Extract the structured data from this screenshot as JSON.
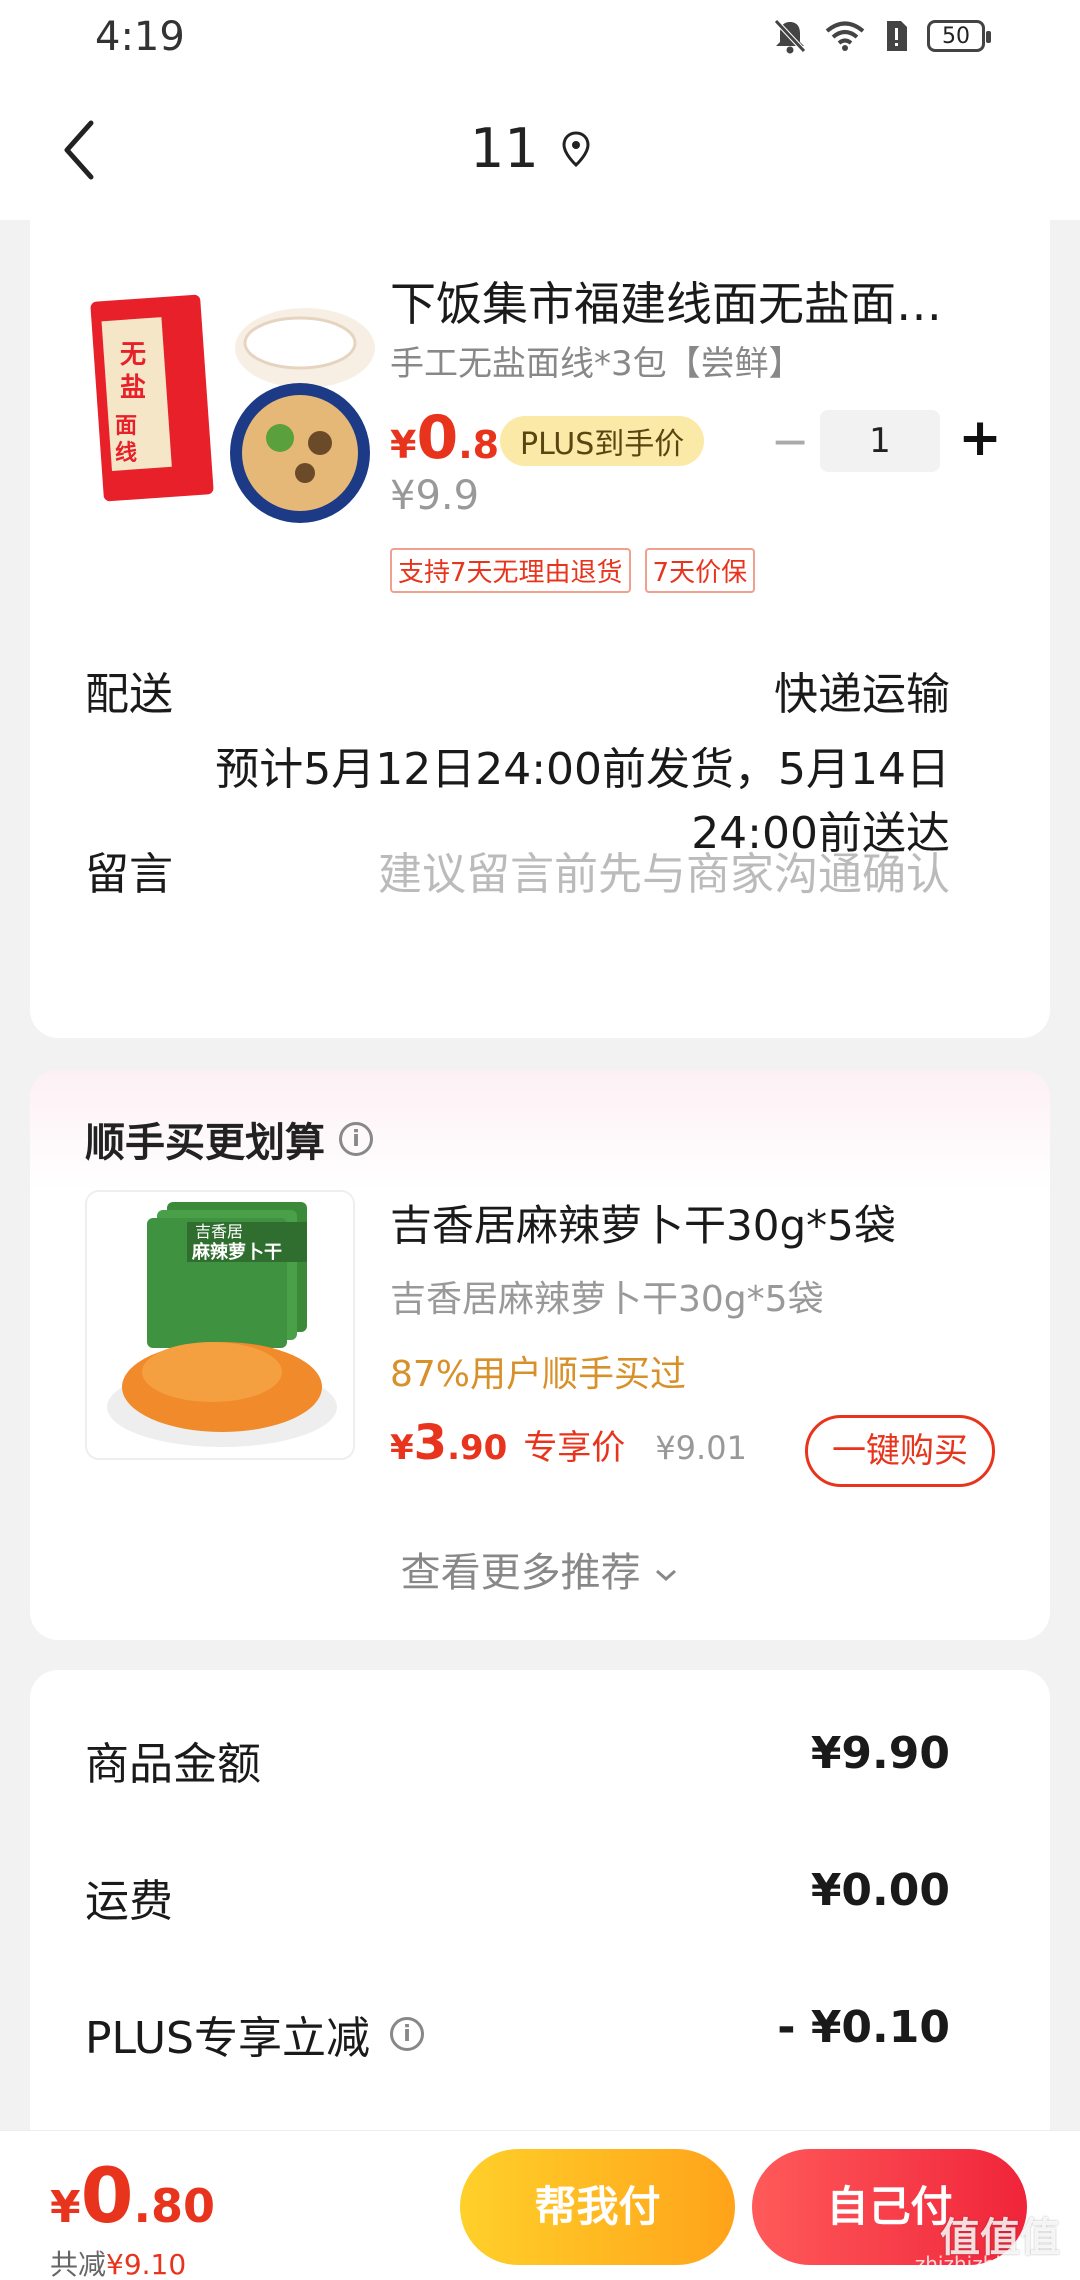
{
  "status": {
    "time": "4:19",
    "battery": "50"
  },
  "nav": {
    "title": "11"
  },
  "product": {
    "title": "下饭集市福建线面无盐面…",
    "subtitle": "手工无盐面线*3包【尝鲜】",
    "price_yen": "¥",
    "price_int": "0",
    "price_dec": ".8",
    "plus_tag": "PLUS到手价",
    "quantity": "1",
    "original_price": "¥9.9",
    "badges": [
      "支持7天无理由退货",
      "7天价保"
    ],
    "image_labels": {
      "package_text": "无盐面线"
    }
  },
  "delivery": {
    "label": "配送",
    "method": "快递运输",
    "note": "预计5月12日24:00前发货，5月14日24:00前送达"
  },
  "message": {
    "label": "留言",
    "placeholder": "建议留言前先与商家沟通确认"
  },
  "recommend": {
    "title": "顺手买更划算",
    "item_name": "吉香居麻辣萝卜干30g*5袋",
    "item_sub": "吉香居麻辣萝卜干30g*5袋",
    "social_proof": "87%用户顺手买过",
    "price_yen": "¥",
    "price_int": "3",
    "price_dec": ".90",
    "price_tag": "专享价",
    "old_price": "¥9.01",
    "buy_label": "一键购买",
    "more_label": "查看更多推荐",
    "image_labels": {
      "brand": "吉香居",
      "product": "麻辣萝卜干"
    }
  },
  "summary": {
    "goods_label": "商品金额",
    "goods_value": "¥9.90",
    "shipping_label": "运费",
    "shipping_value": "¥0.00",
    "plus_label": "PLUS专享立减",
    "plus_value": "- ¥0.10"
  },
  "bottom": {
    "total_yen": "¥",
    "total_int": "0",
    "total_dec": ".80",
    "saving_label": "共减",
    "saving_value": "¥9.10",
    "help_pay_label": "帮我付",
    "self_pay_label": "自己付",
    "watermark": "值值值",
    "watermark_sub": "zhizhizhi.com"
  },
  "colors": {
    "accent_red": "#e8341c",
    "plus_gold": "#fbe9a8",
    "help_pay_yellow": "#ffb41f",
    "self_pay_red": "#f0243a"
  }
}
